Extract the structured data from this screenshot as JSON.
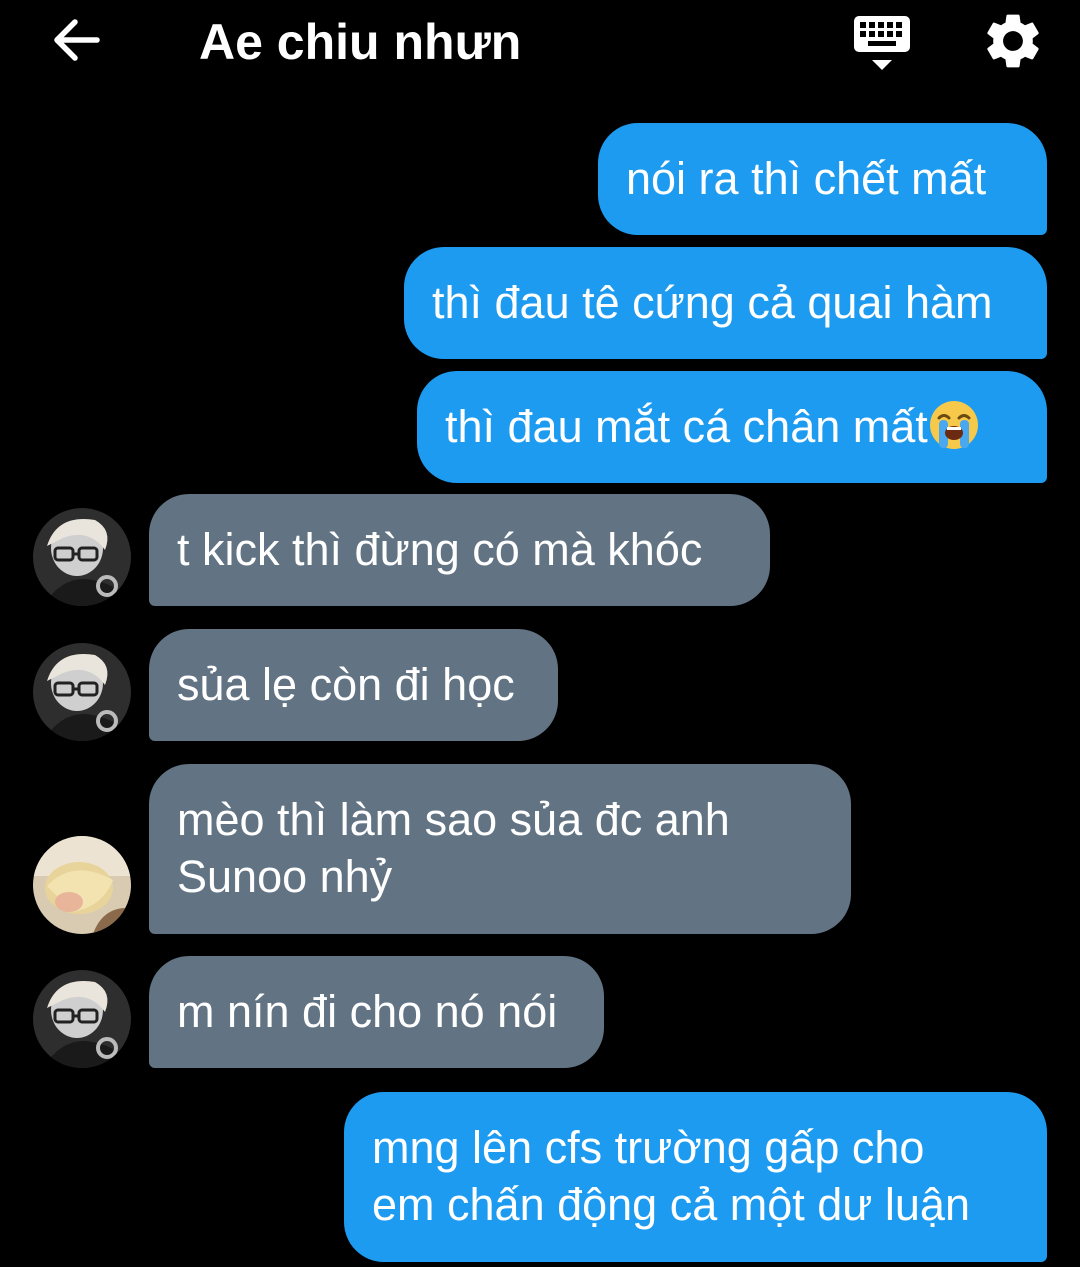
{
  "header": {
    "title": "Ae chiu nhưn",
    "back_icon": "back-arrow-icon",
    "keyboard_icon": "keyboard-hide-icon",
    "settings_icon": "gear-icon"
  },
  "colors": {
    "background": "#000000",
    "outgoing_bubble": "#1d9bf0",
    "incoming_bubble": "#627383",
    "text": "#ffffff"
  },
  "messages": [
    {
      "direction": "outgoing",
      "lines": [
        "nói ra thì chết mất"
      ]
    },
    {
      "direction": "outgoing",
      "lines": [
        "thì đau tê cứng cả quai hàm"
      ]
    },
    {
      "direction": "outgoing",
      "lines": [
        "thì đau mắt cá chân mất"
      ],
      "trailing_emoji": "loudly-crying-face-emoji"
    },
    {
      "direction": "incoming",
      "avatar": "avatar-glasses",
      "lines": [
        "t kick thì đừng có mà khóc"
      ]
    },
    {
      "direction": "incoming",
      "avatar": "avatar-glasses",
      "lines": [
        "sủa lẹ còn đi học"
      ]
    },
    {
      "direction": "incoming",
      "avatar": "avatar-blonde",
      "lines": [
        "mèo thì làm sao sủa đc anh",
        "Sunoo nhỷ"
      ]
    },
    {
      "direction": "incoming",
      "avatar": "avatar-glasses",
      "lines": [
        "m nín đi cho nó nói"
      ]
    },
    {
      "direction": "outgoing",
      "lines": [
        "mng lên cfs trường gấp cho",
        "em chấn động cả một dư luận"
      ]
    }
  ]
}
